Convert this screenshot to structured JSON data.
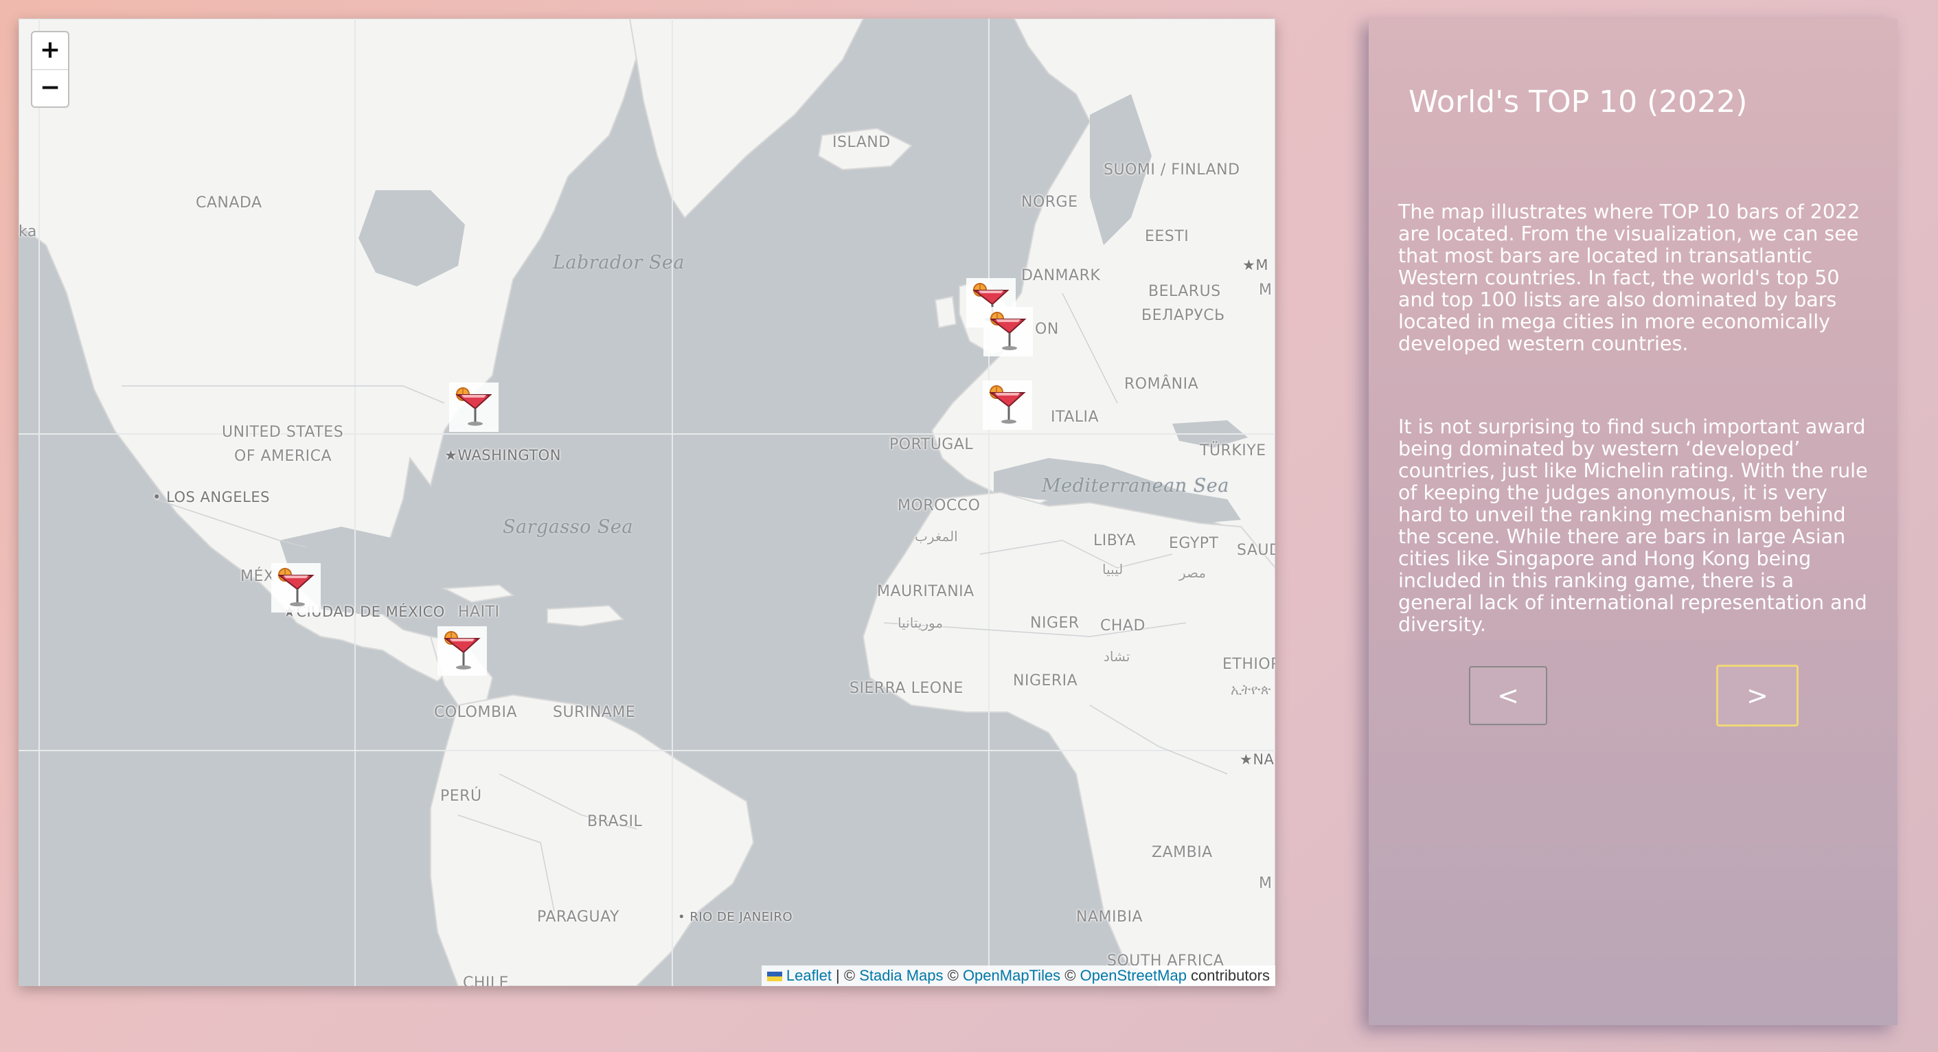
{
  "map": {
    "zoom_in_label": "+",
    "zoom_out_label": "−",
    "labels": {
      "canada": "CANADA",
      "island": "ISLAND",
      "labrador_sea": "Labrador Sea",
      "usa_1": "UNITED STATES",
      "usa_2": "OF AMERICA",
      "washington": "WASHINGTON",
      "los_angeles": "LOS ANGELES",
      "sargasso_sea": "Sargasso Sea",
      "mexico": "MÉX",
      "ciudad_mexico": "CIUDAD DE MÉXICO",
      "haiti": "HAITI",
      "colombia": "COLOMBIA",
      "suriname": "SURINAME",
      "peru": "PERÚ",
      "brasil": "BRASIL",
      "paraguay": "PARAGUAY",
      "rio": "RIO DE JANEIRO",
      "chile": "CHILE",
      "suomi": "SUOMI / FINLAND",
      "norge": "NORGE",
      "eesti": "EESTI",
      "danmark": "DANMARK",
      "belarus_1": "BELARUS",
      "belarus_2": "БЕЛАРУСЬ",
      "london_fragment": "ON",
      "romania": "ROMÂNIA",
      "italia": "ITALIA",
      "portugal": "PORTUGAL",
      "turkiye": "TÜRKIYE",
      "mediterranean": "Mediterranean Sea",
      "morocco": "MOROCCO",
      "morocco_ar": "المغرب",
      "libya": "LIBYA",
      "libya_ar": "ليبيا",
      "egypt": "EGYPT",
      "egypt_ar": "مصر",
      "saudi": "SAUD",
      "mauritania": "MAURITANIA",
      "mauritania_ar": "موريتانيا",
      "niger": "NIGER",
      "chad": "CHAD",
      "chad_ar": "تشاد",
      "ethiopia": "ETHIOP",
      "ethiopia_am": "ኢትዮጵ",
      "sierra_leone": "SIERRA LEONE",
      "nigeria": "NIGERIA",
      "nairobi": "NA",
      "zambia": "ZAMBIA",
      "namibia": "NAMIBIA",
      "south_africa": "SOUTH AFRICA",
      "moscow_1": "M",
      "moscow_2": "M",
      "mozambique": "M",
      "left_edge": "ka"
    },
    "markers": [
      {
        "name": "marker-toronto"
      },
      {
        "name": "marker-london-1"
      },
      {
        "name": "marker-london-2"
      },
      {
        "name": "marker-barcelona"
      },
      {
        "name": "marker-mexico-city"
      },
      {
        "name": "marker-caribbean"
      }
    ],
    "attribution": {
      "leaflet": "Leaflet",
      "sep1": " | © ",
      "stadia": "Stadia Maps",
      "sep2": " © ",
      "omt": "OpenMapTiles",
      "sep3": " © ",
      "osm": "OpenStreetMap",
      "tail": " contributors"
    }
  },
  "panel": {
    "title": "World's TOP 10 (2022)",
    "paragraph_1": "The map illustrates where TOP 10 bars of 2022 are located. From the visualization, we can see that most bars are located in transatlantic Western countries. In fact, the world's top 50 and top 100 lists are also dominated by bars located in mega cities in more economically developed western countries.",
    "paragraph_2": "It is not surprising to find such important award being dominated by western ‘developed’ countries, just like Michelin rating. With the rule of keeping the judges anonymous, it is very hard to unveil the ranking mechanism behind the scene. While there are bars in large Asian cities like Singapore and Hong Kong being included in this ranking game, there is a general lack of international representation and diversity.",
    "prev_label": "<",
    "next_label": ">"
  },
  "colors": {
    "background": "#f0b9ad",
    "panel": "#cfb0b9",
    "water": "#c3c8cc",
    "land": "#f4f4f3",
    "next_border": "#f1d77a"
  }
}
